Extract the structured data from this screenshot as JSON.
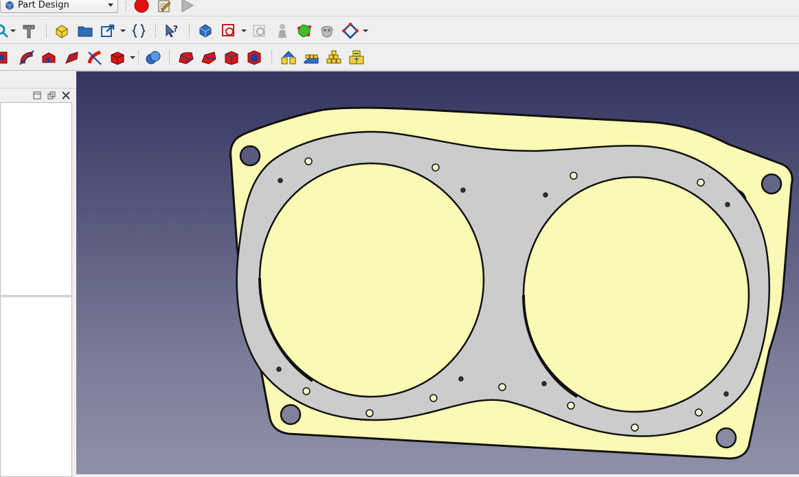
{
  "workbench": {
    "selected": "Part Design",
    "icon": "part-design-icon"
  },
  "macro_toolbar": [
    "macro-record-icon",
    "macro-edit-icon",
    "macro-play-icon"
  ],
  "view_toolbar": [
    "zoom-icon",
    "measure-icon",
    "part-icon",
    "group-icon",
    "link-icon",
    "expression-icon",
    "whats-this-icon"
  ],
  "partdesign_create_toolbar": [
    "body-icon",
    "sketch-icon",
    "validate-sketch-icon",
    "check-geometry-icon",
    "shape-binder-icon",
    "subshape-binder-icon",
    "datum-plane-icon"
  ],
  "partdesign_features_toolbar": [
    "pad-icon",
    "pocket-icon",
    "revolution-icon",
    "groove-icon",
    "loft-icon",
    "sweep-icon",
    "additive-primitive-icon",
    "boolean-icon",
    "fillet-icon",
    "chamfer-icon",
    "draft-icon",
    "thickness-icon",
    "mirrored-icon",
    "linear-pattern-icon",
    "polar-pattern-icon",
    "multitransform-icon"
  ],
  "panel": {
    "buttons": [
      "restore-panel-icon",
      "float-panel-icon",
      "close-panel-icon"
    ]
  },
  "colors": {
    "plate": "#fafab4",
    "gasket": "#cccccc",
    "viewport_top": "#333561",
    "viewport_bottom": "#8f90a8"
  }
}
